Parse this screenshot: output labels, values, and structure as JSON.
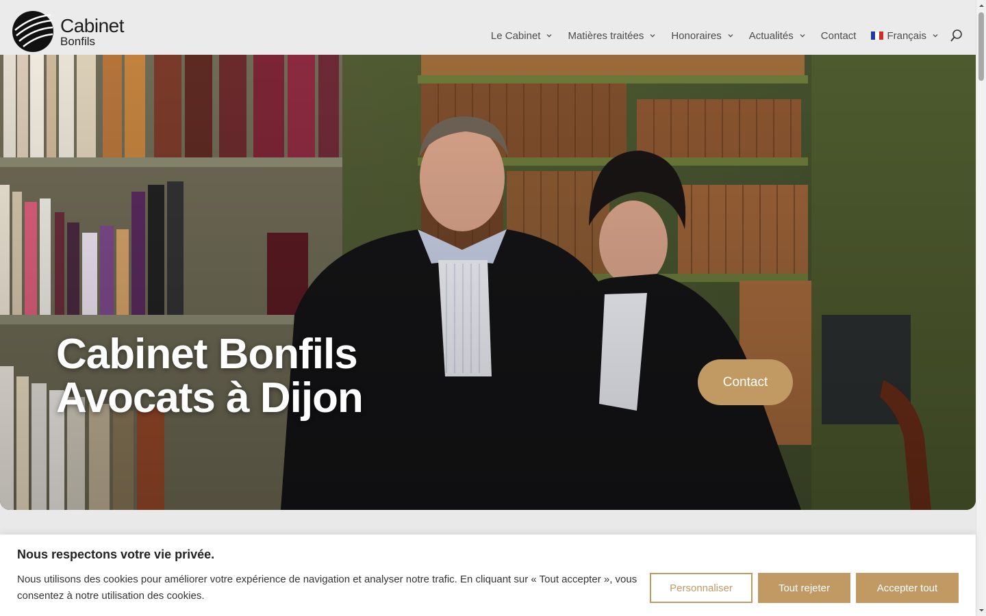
{
  "brand": {
    "title": "Cabinet",
    "subtitle": "Bonfils"
  },
  "nav": {
    "items": [
      {
        "label": "Le Cabinet",
        "has_dropdown": true
      },
      {
        "label": "Matières traitées",
        "has_dropdown": true
      },
      {
        "label": "Honoraires",
        "has_dropdown": true
      },
      {
        "label": "Actualités",
        "has_dropdown": true
      },
      {
        "label": "Contact",
        "has_dropdown": false
      }
    ],
    "language": {
      "label": "Français",
      "flag": "flag-fr-icon"
    },
    "search_icon": "search-icon"
  },
  "hero": {
    "title_line1": "Cabinet Bonfils",
    "title_line2": "Avocats à Dijon",
    "button_label": "Contact"
  },
  "cookie": {
    "title": "Nous respectons votre vie privée.",
    "text": "Nous utilisons des cookies pour améliorer votre expérience de navigation et analyser notre trafic. En cliquant sur « Tout accepter », vous consentez à notre utilisation des cookies.",
    "customize_label": "Personnaliser",
    "reject_label": "Tout rejeter",
    "accept_label": "Accepter tout"
  },
  "colors": {
    "accent": "#c09a62",
    "header_bg": "#ebebeb",
    "text_dark": "#222222"
  }
}
